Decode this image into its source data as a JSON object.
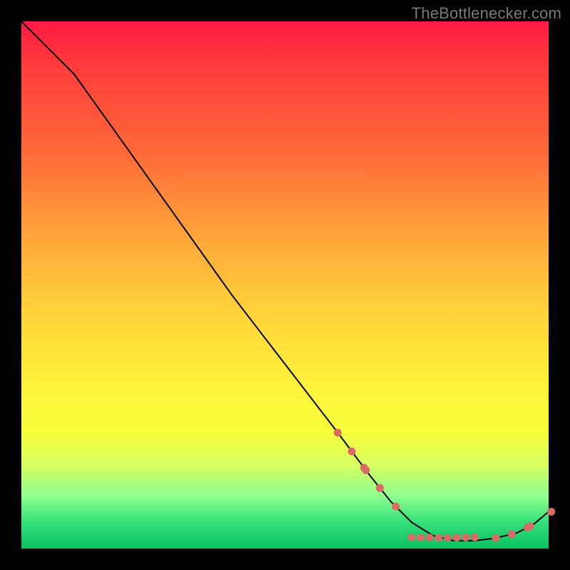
{
  "watermark": "TheBottlenecker.com",
  "colors": {
    "marker": "#d86b63",
    "curve": "#000000",
    "frame_bg_stops": [
      "#ff1a44",
      "#ff3b3b",
      "#ff6a3a",
      "#ffa23a",
      "#ffd23a",
      "#fff43a",
      "#f6ff3a",
      "#d8ff60",
      "#8fff8f",
      "#35e07a",
      "#08c060"
    ]
  },
  "chart_data": {
    "type": "line",
    "title": "",
    "xlabel": "",
    "ylabel": "",
    "xlim": [
      0,
      100
    ],
    "ylim": [
      0,
      100
    ],
    "grid": false,
    "curve": [
      {
        "x": 0,
        "y": 100
      },
      {
        "x": 3,
        "y": 97
      },
      {
        "x": 7,
        "y": 93
      },
      {
        "x": 10,
        "y": 90
      },
      {
        "x": 15,
        "y": 83
      },
      {
        "x": 20,
        "y": 76
      },
      {
        "x": 30,
        "y": 62
      },
      {
        "x": 40,
        "y": 48
      },
      {
        "x": 50,
        "y": 35
      },
      {
        "x": 60,
        "y": 22
      },
      {
        "x": 66,
        "y": 14
      },
      {
        "x": 70,
        "y": 9
      },
      {
        "x": 74,
        "y": 5
      },
      {
        "x": 78,
        "y": 2.5
      },
      {
        "x": 82,
        "y": 1.5
      },
      {
        "x": 86,
        "y": 1.5
      },
      {
        "x": 90,
        "y": 2
      },
      {
        "x": 94,
        "y": 3
      },
      {
        "x": 97,
        "y": 4.5
      },
      {
        "x": 100,
        "y": 7
      }
    ],
    "marker_clusters": [
      {
        "cx": 64,
        "cy": 17,
        "spread": 4,
        "count": 4,
        "along_curve": true
      },
      {
        "cx": 68,
        "cy": 12,
        "spread": 3,
        "count": 3,
        "along_curve": true
      },
      {
        "cx": 80,
        "cy": 2,
        "spread": 6,
        "count": 8,
        "along_curve": false
      },
      {
        "cx": 93,
        "cy": 3,
        "spread": 3,
        "count": 3,
        "along_curve": true
      },
      {
        "cx": 98.5,
        "cy": 5.5,
        "spread": 2,
        "count": 2,
        "along_curve": true
      }
    ]
  }
}
